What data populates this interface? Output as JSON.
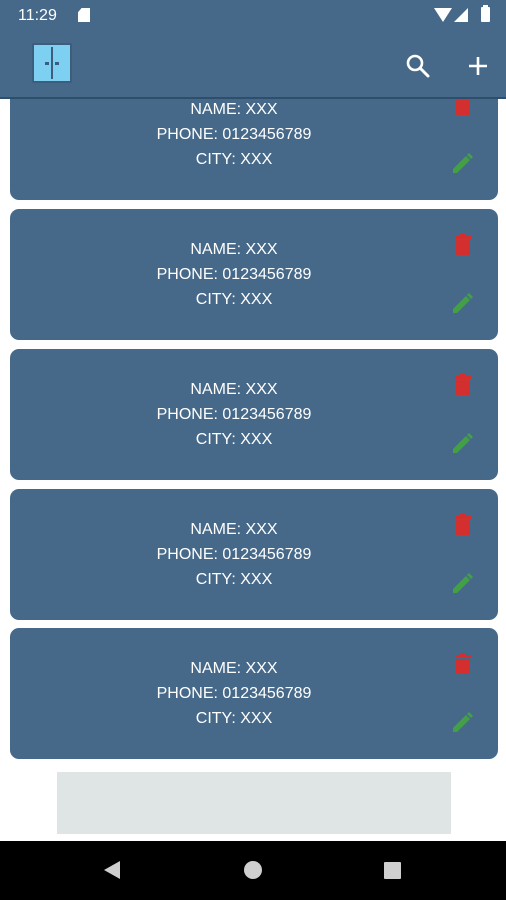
{
  "status_bar": {
    "time": "11:29"
  },
  "app_bar": {
    "logo_icon": "double-door-icon",
    "actions": [
      {
        "name": "search-icon"
      },
      {
        "name": "plus-icon"
      }
    ]
  },
  "colors": {
    "primary": "#46698a",
    "delete": "#d32f2f",
    "edit": "#43a047",
    "ad_background": "#dfe4e4"
  },
  "contacts": [
    {
      "name": "NAME: XXX",
      "phone": "PHONE: 0123456789",
      "city": "CITY: XXX"
    },
    {
      "name": "NAME: XXX",
      "phone": "PHONE: 0123456789",
      "city": "CITY: XXX"
    },
    {
      "name": "NAME: XXX",
      "phone": "PHONE: 0123456789",
      "city": "CITY: XXX"
    },
    {
      "name": "NAME: XXX",
      "phone": "PHONE: 0123456789",
      "city": "CITY: XXX"
    },
    {
      "name": "NAME: XXX",
      "phone": "PHONE: 0123456789",
      "city": "CITY: XXX"
    }
  ],
  "card_icons": {
    "delete": "trash-icon",
    "edit": "pencil-icon"
  },
  "nav_bar": {
    "buttons": [
      "back-icon",
      "home-icon",
      "recents-icon"
    ]
  }
}
